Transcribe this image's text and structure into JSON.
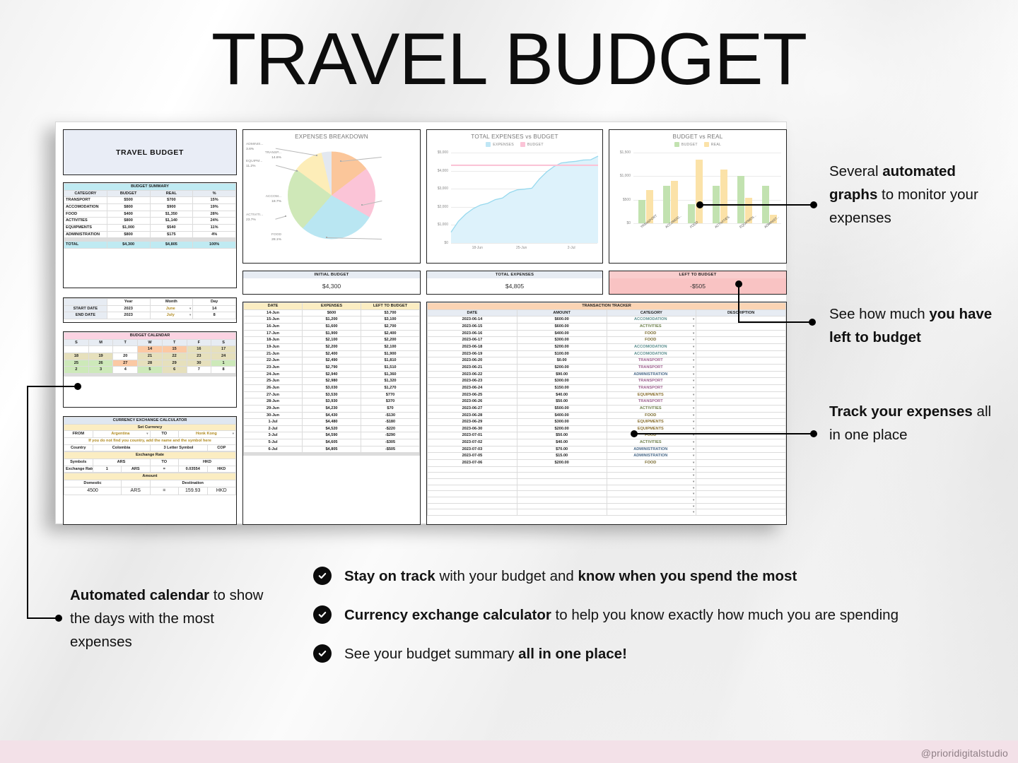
{
  "page": {
    "title": "TRAVEL BUDGET",
    "watermark": "@prioridigitalstudio"
  },
  "sheet": {
    "title_card": "TRAVEL BUDGET",
    "budget_summary": {
      "header": "BUDGET SUMMARY",
      "columns": [
        "CATEGORY",
        "BUDGET",
        "REAL",
        "%"
      ],
      "rows": [
        [
          "TRANSPORT",
          "$500",
          "$700",
          "15%"
        ],
        [
          "ACCOMODATION",
          "$800",
          "$900",
          "19%"
        ],
        [
          "FOOD",
          "$400",
          "$1,350",
          "28%"
        ],
        [
          "ACTIVITIES",
          "$800",
          "$1,140",
          "24%"
        ],
        [
          "EQUIPMENTS",
          "$1,000",
          "$540",
          "11%"
        ],
        [
          "ADMINISTRATION",
          "$800",
          "$175",
          "4%"
        ]
      ],
      "total_row": [
        "TOTAL",
        "$4,300",
        "$4,805",
        "100%"
      ]
    },
    "dates": {
      "columns": [
        "",
        "Year",
        "Month",
        "Day"
      ],
      "rows": [
        [
          "START DATE",
          "2023",
          "June",
          "14"
        ],
        [
          "END DATE",
          "2023",
          "July",
          "8"
        ]
      ]
    },
    "calendar": {
      "header": "BUDGET CALENDAR",
      "weekdays": [
        "S",
        "M",
        "T",
        "W",
        "T",
        "F",
        "S"
      ],
      "weeks": [
        [
          {
            "d": "",
            "c": "none"
          },
          {
            "d": "",
            "c": "none"
          },
          {
            "d": "",
            "c": "none"
          },
          {
            "d": "14",
            "c": "peach"
          },
          {
            "d": "15",
            "c": "peach"
          },
          {
            "d": "16",
            "c": "tan"
          },
          {
            "d": "17",
            "c": "tan"
          }
        ],
        [
          {
            "d": "18",
            "c": "tan"
          },
          {
            "d": "19",
            "c": "tan"
          },
          {
            "d": "20",
            "c": "none"
          },
          {
            "d": "21",
            "c": "tan"
          },
          {
            "d": "22",
            "c": "tan"
          },
          {
            "d": "23",
            "c": "tan"
          },
          {
            "d": "24",
            "c": "tan"
          }
        ],
        [
          {
            "d": "25",
            "c": "green"
          },
          {
            "d": "26",
            "c": "green"
          },
          {
            "d": "27",
            "c": "peach"
          },
          {
            "d": "28",
            "c": "tan"
          },
          {
            "d": "29",
            "c": "tan"
          },
          {
            "d": "30",
            "c": "tan"
          },
          {
            "d": "1",
            "c": "green"
          }
        ],
        [
          {
            "d": "2",
            "c": "green"
          },
          {
            "d": "3",
            "c": "green"
          },
          {
            "d": "4",
            "c": "none"
          },
          {
            "d": "5",
            "c": "green"
          },
          {
            "d": "6",
            "c": "tan"
          },
          {
            "d": "7",
            "c": "none"
          },
          {
            "d": "8",
            "c": "none"
          }
        ]
      ]
    },
    "currency": {
      "header": "CURRENCY EXCHANGE CALCULATOR",
      "set_currency_header": "Set Currency",
      "from_label": "FROM",
      "from_value": "Argentina",
      "to_label": "TO",
      "to_value": "Honk Kong",
      "note": "If you do not find you country, add the name and the symbol here",
      "country_label": "Country",
      "country_value": "Colombia",
      "symbol_label": "3 Letter Symbol",
      "symbol_value": "COP",
      "rate_header": "Exchange Rate",
      "symbols_label": "Symbols",
      "symbols_from": "ARS",
      "symbols_to_label": "TO",
      "symbols_to": "HKD",
      "rate_label": "Exchange Rate",
      "rate_qty": "1",
      "rate_qty_cur": "ARS",
      "rate_eq": "=",
      "rate_value": "0.03554",
      "rate_value_cur": "HKD",
      "amount_header": "Amount",
      "domestic_label": "Domestic",
      "destination_label": "Destination",
      "amount_value": "4500",
      "amount_cur": "ARS",
      "amount_eq": "=",
      "result_value": "159.93",
      "result_cur": "HKD"
    },
    "kpis": [
      {
        "label": "INITIAL BUDGET",
        "value": "$4,300"
      },
      {
        "label": "TOTAL EXPENSES",
        "value": "$4,805"
      },
      {
        "label": "LEFT TO BUDGET",
        "value": "-$505"
      }
    ],
    "expenses_table": {
      "columns": [
        "DATE",
        "EXPENSES",
        "LEFT TO BUDGET"
      ],
      "rows": [
        [
          "14-Jun",
          "$600",
          "$3,700"
        ],
        [
          "15-Jun",
          "$1,200",
          "$3,100"
        ],
        [
          "16-Jun",
          "$1,600",
          "$2,700"
        ],
        [
          "17-Jun",
          "$1,900",
          "$2,400"
        ],
        [
          "18-Jun",
          "$2,100",
          "$2,200"
        ],
        [
          "19-Jun",
          "$2,200",
          "$2,100"
        ],
        [
          "21-Jun",
          "$2,400",
          "$1,900"
        ],
        [
          "22-Jun",
          "$2,490",
          "$1,810"
        ],
        [
          "23-Jun",
          "$2,790",
          "$1,510"
        ],
        [
          "24-Jun",
          "$2,940",
          "$1,360"
        ],
        [
          "25-Jun",
          "$2,980",
          "$1,320"
        ],
        [
          "26-Jun",
          "$3,030",
          "$1,270"
        ],
        [
          "27-Jun",
          "$3,530",
          "$770"
        ],
        [
          "28-Jun",
          "$3,930",
          "$370"
        ],
        [
          "29-Jun",
          "$4,230",
          "$70"
        ],
        [
          "30-Jun",
          "$4,430",
          "-$130"
        ],
        [
          "1-Jul",
          "$4,480",
          "-$180"
        ],
        [
          "2-Jul",
          "$4,520",
          "-$220"
        ],
        [
          "3-Jul",
          "$4,590",
          "-$290"
        ],
        [
          "5-Jul",
          "$4,605",
          "-$305"
        ],
        [
          "6-Jul",
          "$4,805",
          "-$505"
        ]
      ]
    },
    "transaction_tracker": {
      "header": "TRANSACTION TRACKER",
      "columns": [
        "DATE",
        "AMOUNT",
        "CATEGORY",
        "DESCRIPTION"
      ],
      "rows": [
        [
          "2023-06-14",
          "$600.00",
          "ACCOMODATION",
          ""
        ],
        [
          "2023-06-15",
          "$600.00",
          "ACTIVITIES",
          ""
        ],
        [
          "2023-06-16",
          "$400.00",
          "FOOD",
          ""
        ],
        [
          "2023-06-17",
          "$300.00",
          "FOOD",
          ""
        ],
        [
          "2023-06-18",
          "$200.00",
          "ACCOMODATION",
          ""
        ],
        [
          "2023-06-19",
          "$100.00",
          "ACCOMODATION",
          ""
        ],
        [
          "2023-06-20",
          "$0.00",
          "TRANSPORT",
          ""
        ],
        [
          "2023-06-21",
          "$200.00",
          "TRANSPORT",
          ""
        ],
        [
          "2023-06-22",
          "$90.00",
          "ADMINISTRATION",
          ""
        ],
        [
          "2023-06-23",
          "$300.00",
          "TRANSPORT",
          ""
        ],
        [
          "2023-06-24",
          "$150.00",
          "TRANSPORT",
          ""
        ],
        [
          "2023-06-25",
          "$40.00",
          "EQUIPMENTS",
          ""
        ],
        [
          "2023-06-26",
          "$50.00",
          "TRANSPORT",
          ""
        ],
        [
          "2023-06-27",
          "$500.00",
          "ACTIVITIES",
          ""
        ],
        [
          "2023-06-28",
          "$400.00",
          "FOOD",
          ""
        ],
        [
          "2023-06-29",
          "$300.00",
          "EQUIPMENTS",
          ""
        ],
        [
          "2023-06-30",
          "$200.00",
          "EQUIPMENTS",
          ""
        ],
        [
          "2023-07-01",
          "$50.00",
          "FOOD",
          ""
        ],
        [
          "2023-07-02",
          "$40.00",
          "ACTIVITIES",
          ""
        ],
        [
          "2023-07-03",
          "$70.00",
          "ADMINISTRATION",
          ""
        ],
        [
          "2023-07-05",
          "$15.00",
          "ADMINISTRATION",
          ""
        ],
        [
          "2023-07-06",
          "$200.00",
          "FOOD",
          ""
        ]
      ]
    }
  },
  "chart_data": [
    {
      "type": "pie",
      "title": "EXPENSES BREAKDOWN",
      "labels": [
        "TRANSP...",
        "ACCOM...",
        "FOOD",
        "ACTIVITI...",
        "EQUIPM...",
        "ADMINIS..."
      ],
      "values": [
        14.6,
        18.7,
        28.1,
        23.7,
        11.2,
        3.6
      ],
      "value_labels": [
        "14.6%",
        "18.7%",
        "28.1%",
        "23.7%",
        "11.2%",
        "3.6%"
      ],
      "colors": [
        "#fbc69a",
        "#fbc4d7",
        "#b9e6f2",
        "#cfe8b8",
        "#fdedb8",
        "#e3e8f0"
      ],
      "legend": "none"
    },
    {
      "type": "area",
      "title": "TOTAL EXPENSES vs BUDGET",
      "legend": [
        "EXPENSES",
        "BUDGET"
      ],
      "legend_colors": [
        "#bfe6f5",
        "#fbc4d7"
      ],
      "ylabel": "",
      "xlabel": "",
      "ylim": [
        0,
        5000
      ],
      "yticks": [
        "$0",
        "$1,000",
        "$2,000",
        "$3,000",
        "$4,000",
        "$5,000"
      ],
      "xticks": [
        "18-Jun",
        "25-Jun",
        "2-Jul"
      ],
      "series": [
        {
          "name": "EXPENSES",
          "values": [
            600,
            1200,
            1600,
            1900,
            2100,
            2200,
            2400,
            2490,
            2790,
            2940,
            2980,
            3030,
            3530,
            3930,
            4230,
            4430,
            4480,
            4520,
            4590,
            4605,
            4805
          ]
        },
        {
          "name": "BUDGET",
          "values": [
            4300,
            4300,
            4300,
            4300,
            4300,
            4300,
            4300,
            4300,
            4300,
            4300,
            4300,
            4300,
            4300,
            4300,
            4300,
            4300,
            4300,
            4300,
            4300,
            4300,
            4300
          ]
        }
      ],
      "x": [
        "14-Jun",
        "15-Jun",
        "16-Jun",
        "17-Jun",
        "18-Jun",
        "19-Jun",
        "21-Jun",
        "22-Jun",
        "23-Jun",
        "24-Jun",
        "25-Jun",
        "26-Jun",
        "27-Jun",
        "28-Jun",
        "29-Jun",
        "30-Jun",
        "1-Jul",
        "2-Jul",
        "3-Jul",
        "5-Jul",
        "6-Jul"
      ],
      "grid": true
    },
    {
      "type": "bar",
      "title": "BUDGET vs REAL",
      "legend": [
        "BUDGET",
        "REAL"
      ],
      "legend_colors": [
        "#c2e2b0",
        "#fbe2a8"
      ],
      "categories": [
        "TRANSPORT",
        "ACCOMOD...",
        "FOOD",
        "ACTIVITIES",
        "EQUIPMEN...",
        "ADMINIST..."
      ],
      "series": [
        {
          "name": "BUDGET",
          "values": [
            500,
            800,
            400,
            800,
            1000,
            800
          ]
        },
        {
          "name": "REAL",
          "values": [
            700,
            900,
            1350,
            1140,
            540,
            175
          ]
        }
      ],
      "ylim": [
        0,
        1500
      ],
      "yticks": [
        "$0",
        "$500",
        "$1,000",
        "$1,500"
      ],
      "grid": true
    }
  ],
  "annotations": {
    "graphs": {
      "plain1": "Several ",
      "bold1": "automated graphs",
      "plain2": " to monitor your expenses"
    },
    "left_budget": {
      "plain1": "See how much ",
      "bold1": "you have left to budget"
    },
    "track": {
      "bold1": "Track your expenses",
      "plain1": " all in one place"
    },
    "calendar": {
      "bold1": "Automated calendar",
      "plain1": " to show the days with the most expenses"
    }
  },
  "bullets": [
    {
      "b1": "Stay on track",
      "p1": " with your budget and ",
      "b2": "know when you spend the most",
      "p2": ""
    },
    {
      "b1": "Currency exchange calculator",
      "p1": " to help you know exactly how much you are spending",
      "b2": "",
      "p2": ""
    },
    {
      "b1": "",
      "p1": "See your budget summary ",
      "b2": "all in one place!",
      "p2": ""
    }
  ]
}
